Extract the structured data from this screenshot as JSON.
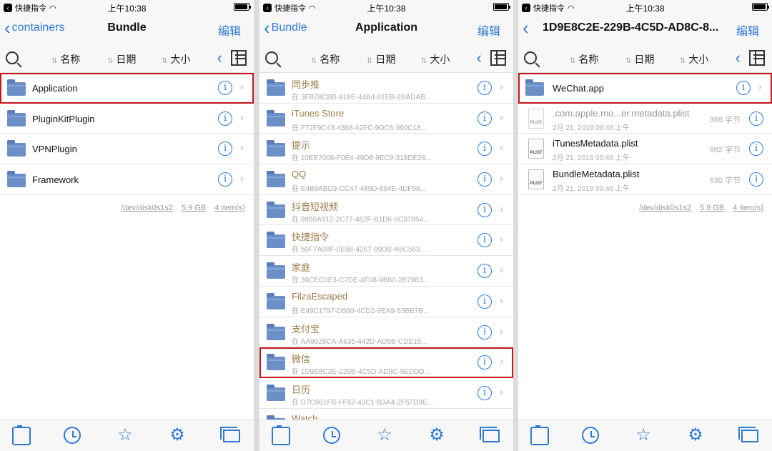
{
  "status": {
    "carrier": "快捷指令",
    "time": "上午10:38"
  },
  "panel1": {
    "back": "containers",
    "title": "Bundle",
    "edit": "编辑",
    "sort": [
      "名称",
      "日期",
      "大小"
    ],
    "rows": [
      "Application",
      "PluginKitPlugin",
      "VPNPlugin",
      "Framework"
    ],
    "footer": {
      "disk": "/dev/disk0s1s2",
      "size": "5.9 GB",
      "count": "4 item(s)"
    }
  },
  "panel2": {
    "back": "Bundle",
    "title": "Application",
    "edit": "编辑",
    "sort": [
      "名称",
      "日期",
      "大小"
    ],
    "rows": [
      {
        "name": "同步推",
        "sub": "在 3FB78CBB-818E-44B4-81EB-2BADAB..."
      },
      {
        "name": "iTunes Store",
        "sub": "在 F72F9C43-4368-42FC-9DC6-390C18..."
      },
      {
        "name": "提示",
        "sub": "在 10EE7006-F0E4-49D8-9EC9-318DE28..."
      },
      {
        "name": "QQ",
        "sub": "在 E4B9ABD3-CC47-489D-894E-4DF98..."
      },
      {
        "name": "抖音短视频",
        "sub": "在 9956A912-2C77-462F-B1D6-9C97854..."
      },
      {
        "name": "快捷指令",
        "sub": "在 50F7A08F-0E66-4267-99DB-A6C563..."
      },
      {
        "name": "家庭",
        "sub": "在 39CEC0E3-C7DE-4F08-9B80-2B7983..."
      },
      {
        "name": "FilzaEscaped",
        "sub": "在 E49C1797-D580-4CD2-9EA9-53BE7B..."
      },
      {
        "name": "支付宝",
        "sub": "在 AA9928CA-A635-442D-AD5B-CDE15..."
      },
      {
        "name": "微信",
        "sub": "在 1D9E8C2E-229B-4C5D-AD8C-8EDDD..."
      },
      {
        "name": "日历",
        "sub": "在 D7C661FB-FF52-43C1-B3A4-2F57D9E..."
      },
      {
        "name": "Watch",
        "sub": ""
      }
    ]
  },
  "panel3": {
    "title": "1D9E8C2E-229B-4C5D-AD8C-8...",
    "edit": "编辑",
    "sort": [
      "名称",
      "日期",
      "大小"
    ],
    "app": "WeChat.app",
    "files": [
      {
        "name": ".com.apple.mo...er.metadata.plist",
        "date": "2月 21, 2019 09:46 上午",
        "size": "368 字节"
      },
      {
        "name": "iTunesMetadata.plist",
        "date": "2月 21, 2019 09:46 上午",
        "size": "982 字节"
      },
      {
        "name": "BundleMetadata.plist",
        "date": "2月 21, 2019 09:46 上午",
        "size": "630 字节"
      }
    ],
    "plist_label": "PLIST",
    "footer": {
      "disk": "/dev/disk0s1s2",
      "size": "5.9 GB",
      "count": "4 item(s)"
    }
  },
  "colors": {
    "accent": "#2f7bd2",
    "highlight": "#c8161d",
    "folder": "#6d8fc8"
  }
}
